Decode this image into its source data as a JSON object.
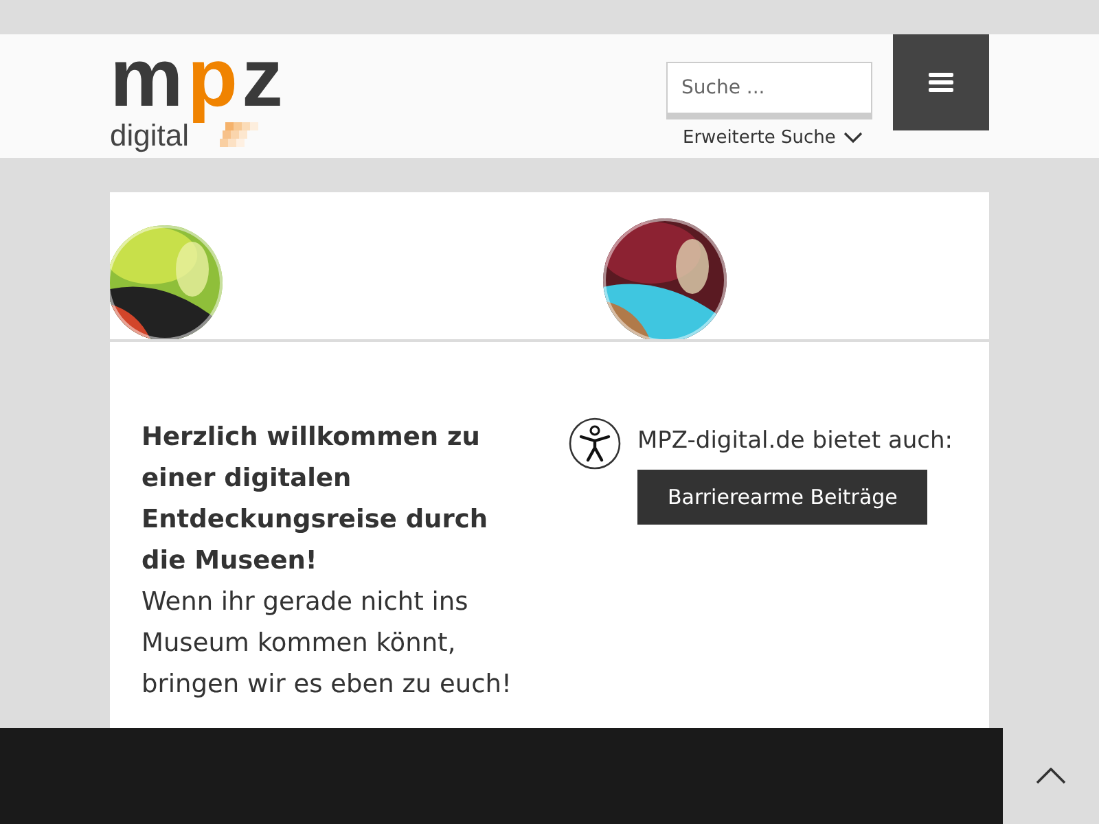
{
  "header": {
    "logo": {
      "letters": [
        {
          "text": "m",
          "color": "#3a3a3a"
        },
        {
          "text": "p",
          "color": "#f08300"
        },
        {
          "text": "z",
          "color": "#3a3a3a"
        }
      ],
      "tagline": "digital"
    },
    "search": {
      "placeholder": "Suche ..."
    },
    "advanced_search": "Erweiterte Suche"
  },
  "content": {
    "heading": "Herzlich willkommen zu einer digitalen Entdeckungsreise durch die Museen!",
    "body": "Wenn ihr gerade nicht ins Museum kommen könnt, bringen wir es eben zu euch!",
    "accessibility_text": "MPZ-digital.de bietet auch:",
    "accessibility_button": "Barrierearme Beiträge"
  }
}
